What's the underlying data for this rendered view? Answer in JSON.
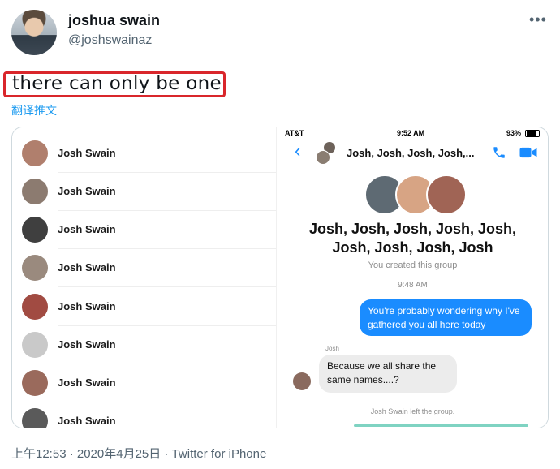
{
  "tweet": {
    "display_name": "joshua swain",
    "handle": "@joshswainaz",
    "text": "there can only be one",
    "translate_label": "翻译推文",
    "more_icon": "more-dots-icon",
    "meta": "上午12:53 · 2020年4月25日 · Twitter for iPhone"
  },
  "contacts": [
    {
      "name": "Josh Swain",
      "color": "#b07f6d"
    },
    {
      "name": "Josh Swain",
      "color": "#8c7b70"
    },
    {
      "name": "Josh Swain",
      "color": "#3f3f3f"
    },
    {
      "name": "Josh Swain",
      "color": "#9a8a7e"
    },
    {
      "name": "Josh Swain",
      "color": "#a14b42"
    },
    {
      "name": "Josh Swain",
      "color": "#c9c9c9"
    },
    {
      "name": "Josh Swain",
      "color": "#9a6a5c"
    },
    {
      "name": "Josh Swain",
      "color": "#5a5a5a"
    }
  ],
  "chat": {
    "carrier": "AT&T",
    "time": "9:52 AM",
    "battery": "93%",
    "title": "Josh, Josh, Josh, Josh,...",
    "group_name_line1": "Josh, Josh, Josh, Josh, Josh,",
    "group_name_line2": "Josh, Josh, Josh, Josh",
    "created": "You created this group",
    "message_time": "9:48 AM",
    "outgoing": "You're probably wondering why I've gathered you all here today",
    "sender": "Josh",
    "incoming": "Because we all share the same names....?",
    "system": "Josh Swain left the group.",
    "accent_color": "#1a8cff"
  }
}
